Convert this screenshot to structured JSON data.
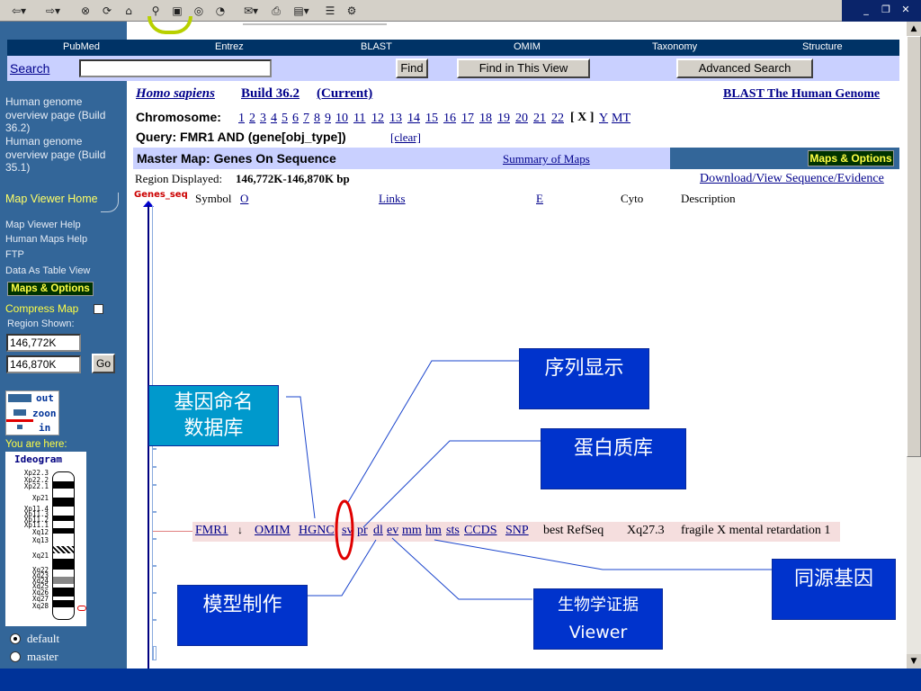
{
  "nav": {
    "tabs": [
      "PubMed",
      "Entrez",
      "BLAST",
      "OMIM",
      "Taxonomy",
      "Structure"
    ]
  },
  "search": {
    "label": "Search",
    "value": "",
    "find": "Find",
    "find_view": "Find in This View",
    "advanced": "Advanced Search"
  },
  "sidebar": {
    "genome_pages": [
      "Human genome overview page (Build 36.2)",
      "Human genome overview page (Build 35.1)"
    ],
    "home": "Map Viewer Home",
    "links": [
      "Map Viewer Help",
      "Human Maps Help",
      "FTP",
      "Data As Table View"
    ],
    "maps_options": "Maps & Options",
    "compress": "Compress Map",
    "region_shown": "Region Shown:",
    "region_from": "146,772K",
    "region_to": "146,870K",
    "go": "Go",
    "zoom_out": "out",
    "zoom_zoon": "zoon",
    "zoom_in": "in",
    "here": "You are here:",
    "ideogram_title": "Ideogram",
    "bands": [
      "Xp22.3",
      "Xp22.2",
      "Xp22.1",
      "Xp21",
      "Xp11.4",
      "Xp11.3",
      "Xp11.2",
      "Xp11.1",
      "Xq12",
      "Xq13",
      "Xq21",
      "Xq22",
      "Xq23",
      "Xq24",
      "Xq25",
      "Xq26",
      "Xq27",
      "Xq28"
    ],
    "radio_default": "default",
    "radio_master": "master"
  },
  "header": {
    "species": "Homo sapiens",
    "build": "Build 36.2",
    "current": "(Current)",
    "blast": "BLAST The Human Genome"
  },
  "chromosome": {
    "label": "Chromosome:",
    "nums": [
      "1",
      "2",
      "3",
      "4",
      "5",
      "6",
      "7",
      "8",
      "9",
      "10",
      "11",
      "12",
      "13",
      "14",
      "15",
      "16",
      "17",
      "18",
      "19",
      "20",
      "21",
      "22"
    ],
    "current": "[ X ]",
    "others": [
      "Y",
      "MT"
    ]
  },
  "query": {
    "text": "Query: FMR1 AND (gene[obj_type])",
    "clear": "[clear]"
  },
  "master": {
    "title": "Master Map: Genes On Sequence",
    "summary": "Summary of Maps",
    "maps_options": "Maps & Options"
  },
  "region": {
    "label": "Region Displayed:",
    "value": "146,772K-146,870K bp",
    "download": "Download/View Sequence/Evidence"
  },
  "columns": {
    "track": "Genes_seq",
    "symbol": "Symbol",
    "symbol_o": "O",
    "links": "Links",
    "e": "E",
    "cyto": "Cyto",
    "desc": "Description"
  },
  "gene_row": {
    "symbol": "FMR1",
    "arrow": "↓",
    "links": [
      "OMIM",
      "HGNC",
      "sv",
      "pr",
      "dl",
      "ev",
      "mm",
      "hm",
      "sts",
      "CCDS",
      "SNP"
    ],
    "refseq": "best RefSeq",
    "cyto": "Xq27.3",
    "desc": "fragile X mental retardation 1"
  },
  "callouts": {
    "nomenclature_1": "基因命名",
    "nomenclature_2": "数据库",
    "sequence": "序列显示",
    "protein": "蛋白质库",
    "model": "模型制作",
    "evidence_1": "生物学证据",
    "evidence_2": "Viewer",
    "homolog": "同源基因"
  },
  "colors": {
    "sidebar": "#336699",
    "navbar": "#003366",
    "searchbar": "#c9d0ff",
    "master_bar": "#c9d0ff",
    "callout": "#0033cc",
    "callout_cyan": "#0099cc",
    "gene_row": "#f5dede",
    "circle": "#e00000"
  }
}
